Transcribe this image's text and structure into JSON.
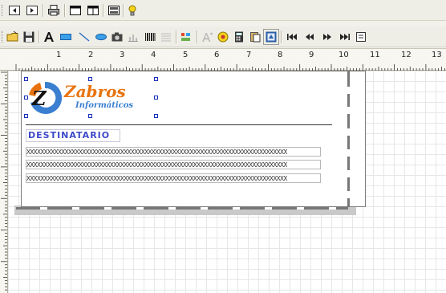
{
  "ruler": {
    "marks": [
      "1",
      "2",
      "3",
      "4",
      "5",
      "6",
      "7",
      "8",
      "9",
      "10",
      "11",
      "12",
      "13"
    ]
  },
  "logo": {
    "initials_z": "Z",
    "initials_s": "s",
    "brand": "Zabros",
    "sub": "Informáticos"
  },
  "report": {
    "recipient_label": "DESTINATARIO",
    "placeholder_rows": [
      "XXXXXXXXXXXXXXXXXXXXXXXXXXXXXXXXXXXXXXXXXXXXXXXXXXXXXXXXXXXXXXXXXXXXXXXXXXX",
      "XXXXXXXXXXXXXXXXXXXXXXXXXXXXXXXXXXXXXXXXXXXXXXXXXXXXXXXXXXXXXXXXXXXXXXXXXXX",
      "XXXXXXXXXXXXXXXXXXXXXXXXXXXXXXXXXXXXXXXXXXXXXXXXXXXXXXXXXXXXXXXXXXXXXXXXXXX"
    ]
  },
  "colors": {
    "accent": "#3d49c9",
    "logo_orange": "#e8730e",
    "logo_blue": "#3a7fd0",
    "selection": "#1a2fb8"
  }
}
